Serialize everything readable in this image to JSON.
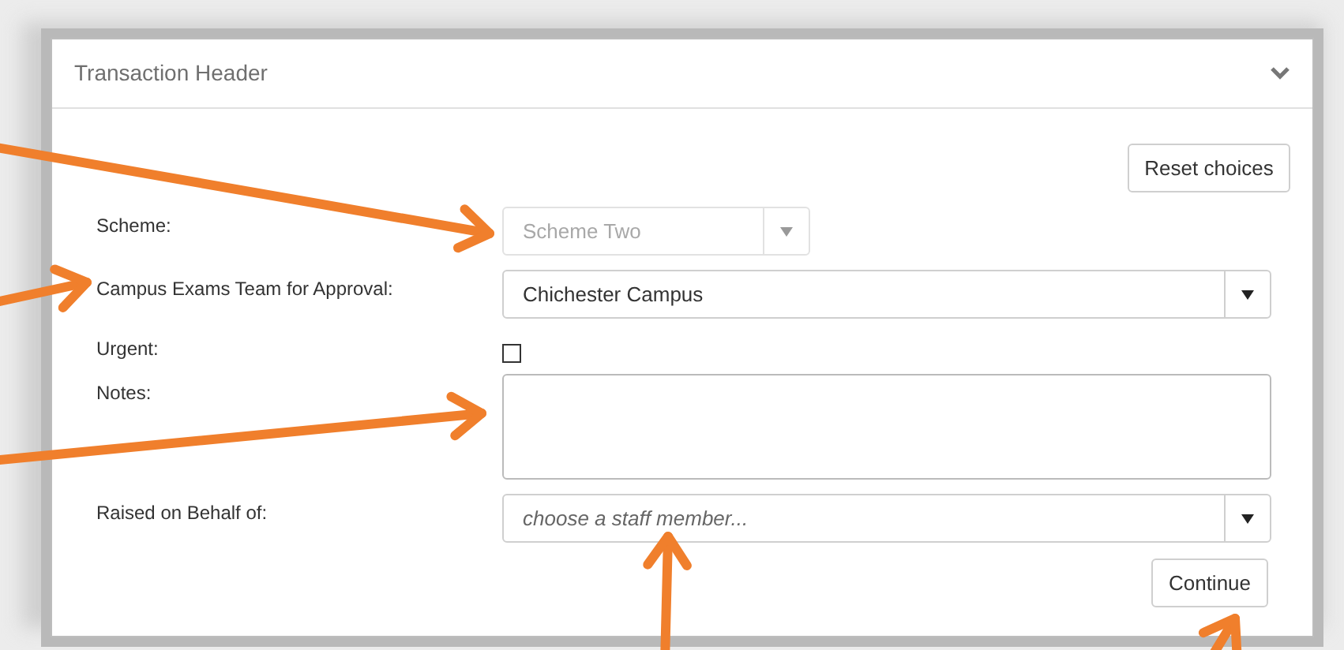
{
  "panel": {
    "title": "Transaction Header",
    "expanded": true
  },
  "reset_button": "Reset choices",
  "fields": [
    {
      "kind": "select",
      "label": "Scheme:",
      "value": "Scheme Two",
      "disabled": true
    },
    {
      "kind": "select",
      "label": "Campus Exams Team for Approval:",
      "value": "Chichester Campus",
      "disabled": false
    },
    {
      "kind": "checkbox",
      "label": "Urgent:",
      "checked": false
    },
    {
      "kind": "textarea",
      "label": "Notes:"
    },
    {
      "kind": "select",
      "label": "Raised on Behalf of:",
      "placeholder": "choose a staff member...",
      "disabled": false
    }
  ],
  "continue_button": "Continue"
}
